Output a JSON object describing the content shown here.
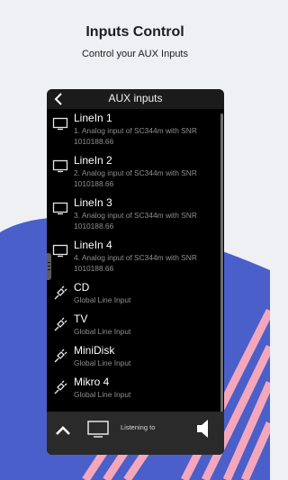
{
  "promo": {
    "title": "Inputs Control",
    "subtitle": "Control your AUX Inputs"
  },
  "appbar": {
    "title": "AUX inputs",
    "back_icon": "chevron-left-icon"
  },
  "inputs": [
    {
      "name": "LineIn 1",
      "description": "1. Analog input of SC344m with SNR 1010188.66",
      "icon": "tv-icon"
    },
    {
      "name": "LineIn 2",
      "description": "2. Analog input of SC344m with SNR 1010188.66",
      "icon": "tv-icon"
    },
    {
      "name": "LineIn 3",
      "description": "3. Analog input of SC344m with SNR 1010188.66",
      "icon": "tv-icon"
    },
    {
      "name": "LineIn 4",
      "description": "4. Analog input of SC344m with SNR 1010188.66",
      "icon": "tv-icon"
    },
    {
      "name": "CD",
      "description": "Global Line Input",
      "icon": "plug-icon"
    },
    {
      "name": "TV",
      "description": "Global Line Input",
      "icon": "plug-icon"
    },
    {
      "name": "MiniDisk",
      "description": "Global Line Input",
      "icon": "plug-icon"
    },
    {
      "name": "Mikro 4",
      "description": "Global Line Input",
      "icon": "plug-icon"
    }
  ],
  "bottombar": {
    "listening_label": "Listening to",
    "up_icon": "chevron-up-icon",
    "tv_icon": "tv-icon",
    "speaker_icon": "speaker-icon"
  },
  "colors": {
    "background": "#eef0f4",
    "blob": "#4a5fc9",
    "stripes": "#f4a7bb",
    "panel": "#000000",
    "bottombar": "#2a2a2a"
  }
}
